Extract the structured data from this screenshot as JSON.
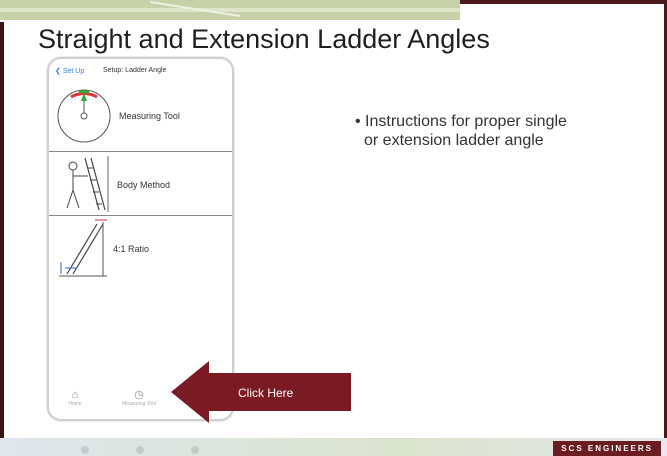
{
  "slide": {
    "title": "Straight and Extension Ladder Angles",
    "bullet": "Instructions for proper single or extension ladder angle",
    "bullet_line1": "Instructions for proper single",
    "bullet_line2": "or extension ladder angle"
  },
  "phone": {
    "back_label": "Set Up",
    "header_title": "Setup: Ladder Angle",
    "menu": [
      {
        "label": "Measuring Tool",
        "icon": "gauge-icon"
      },
      {
        "label": "Body Method",
        "icon": "person-ladder-icon"
      },
      {
        "label": "4:1 Ratio",
        "icon": "ladder-diagram-icon"
      }
    ],
    "tabs": [
      {
        "label": "Home",
        "icon": "home-icon"
      },
      {
        "label": "Measuring Tool",
        "icon": "gauge-icon"
      }
    ]
  },
  "callout": {
    "label": "Click Here",
    "color": "#7a1a22"
  },
  "brand": {
    "logo_text": "SCS ENGINEERS",
    "color": "#6a1c20"
  }
}
